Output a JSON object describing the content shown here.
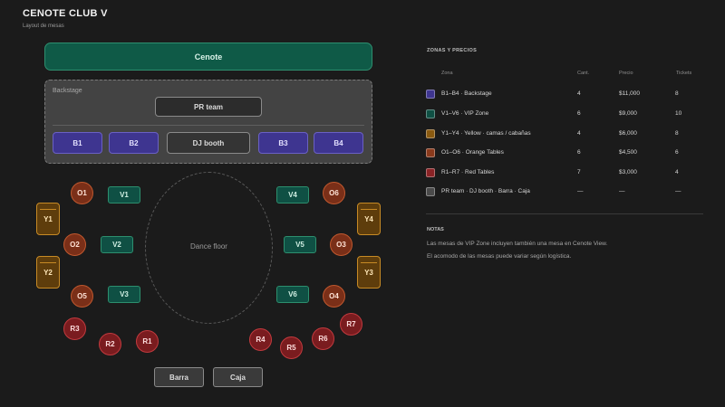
{
  "header": {
    "title": "CENOTE CLUB V",
    "subtitle": "Layout de mesas"
  },
  "venue": {
    "cenote": "Cenote",
    "backstage_label": "Backstage",
    "pr_team": "PR team",
    "dj_booth": "DJ booth",
    "dance_floor": "Dance floor",
    "barra": "Barra",
    "caja": "Caja"
  },
  "tables": {
    "b1": "B1",
    "b2": "B2",
    "b3": "B3",
    "b4": "B4",
    "v1": "V1",
    "v2": "V2",
    "v3": "V3",
    "v4": "V4",
    "v5": "V5",
    "v6": "V6",
    "o1": "O1",
    "o2": "O2",
    "o3": "O3",
    "o4": "O4",
    "o5": "O5",
    "o6": "O6",
    "y1": "Y1",
    "y2": "Y2",
    "y3": "Y3",
    "y4": "Y4",
    "r1": "R1",
    "r2": "R2",
    "r3": "R3",
    "r4": "R4",
    "r5": "R5",
    "r6": "R6",
    "r7": "R7"
  },
  "legend": {
    "title": "ZONAS Y PRECIOS",
    "headers": {
      "zona": "Zona",
      "cant": "Cant.",
      "precio": "Precio",
      "tickets": "Tickets"
    },
    "rows": [
      {
        "zona": "B1–B4 · Backstage",
        "cant": "4",
        "precio": "$11,000",
        "tickets": "8",
        "color": "#3e3590"
      },
      {
        "zona": "V1–V6 · VIP Zone",
        "cant": "6",
        "precio": "$9,000",
        "tickets": "10",
        "color": "#0f5044"
      },
      {
        "zona": "Y1–Y4 · Yellow · camas / cabañas",
        "cant": "4",
        "precio": "$6,000",
        "tickets": "8",
        "color": "#8a5a10"
      },
      {
        "zona": "O1–O6 · Orange Tables",
        "cant": "6",
        "precio": "$4,500",
        "tickets": "6",
        "color": "#8a3a1c"
      },
      {
        "zona": "R1–R7 · Red Tables",
        "cant": "7",
        "precio": "$3,000",
        "tickets": "4",
        "color": "#8a2326"
      },
      {
        "zona": "PR team · DJ booth · Barra · Caja",
        "cant": "—",
        "precio": "—",
        "tickets": "—",
        "color": "#4a4a4a"
      }
    ]
  },
  "notes": {
    "title": "NOTAS",
    "items": [
      "Las mesas de VIP Zone incluyen también una mesa en Cenote View.",
      "El acomodo de las mesas puede variar según logística."
    ]
  }
}
